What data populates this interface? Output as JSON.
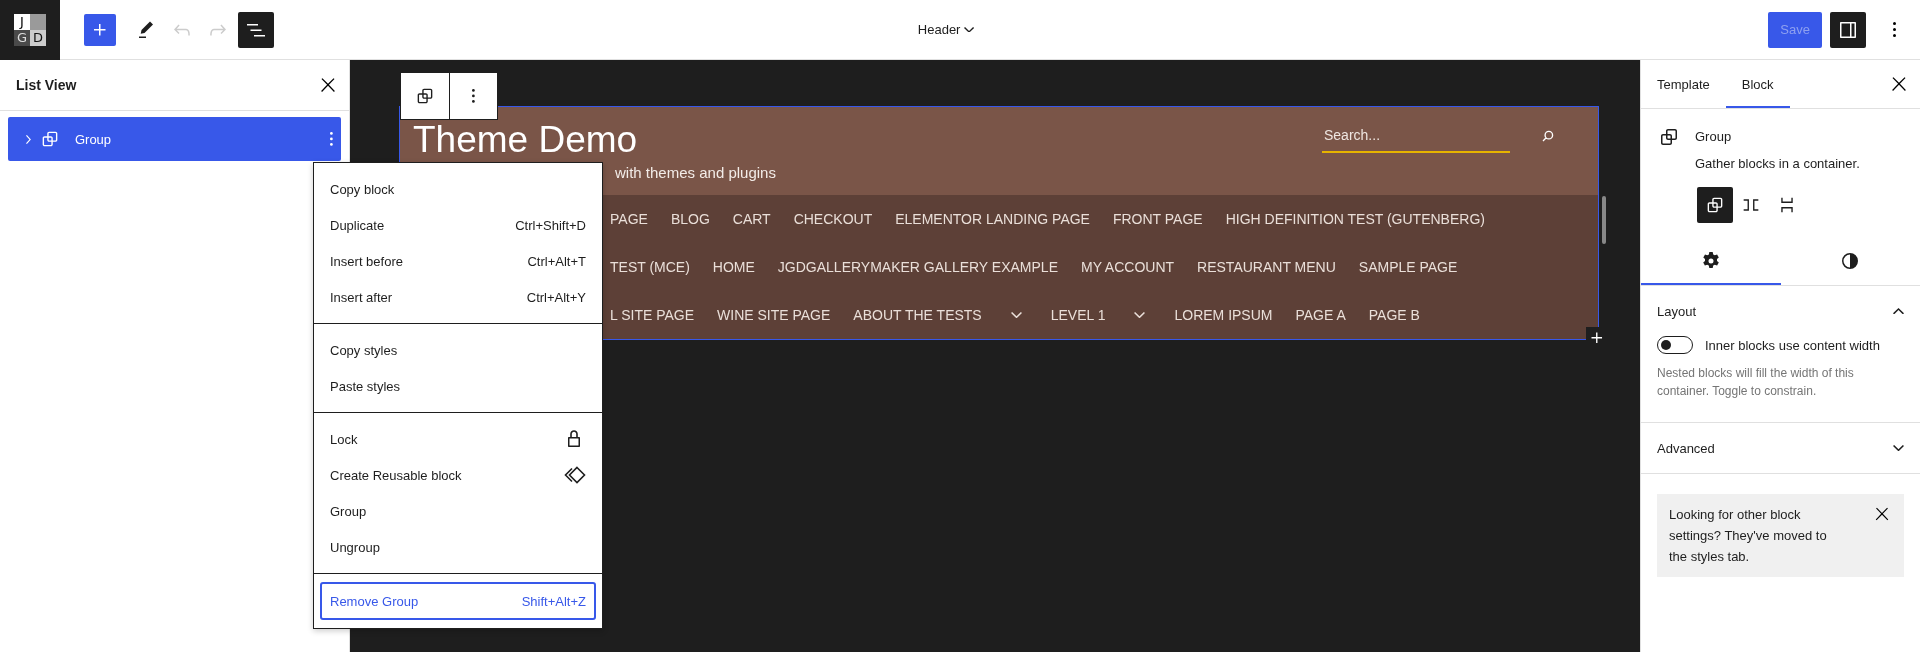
{
  "top_bar": {
    "logo": {
      "letters": [
        "J",
        "G",
        "D"
      ]
    },
    "tools": [
      {
        "kind": "add",
        "pressed": false,
        "disabled": false
      },
      {
        "kind": "edit",
        "pressed": false,
        "disabled": false
      },
      {
        "kind": "undo",
        "pressed": false,
        "disabled": true
      },
      {
        "kind": "redo",
        "pressed": false,
        "disabled": true
      },
      {
        "kind": "list-view",
        "pressed": true,
        "disabled": false
      }
    ],
    "document_title": "Header",
    "save": {
      "label": "Save",
      "disabled": true
    },
    "settings_toggle": {
      "pressed": true
    }
  },
  "list_view": {
    "title": "List View",
    "items": [
      {
        "label": "Group",
        "selected": true,
        "expanded": false
      }
    ]
  },
  "header_block": {
    "site_title": "Theme Demo",
    "tagline": "with themes and plugins",
    "search": {
      "placeholder": "Search..."
    },
    "nav_rows": [
      [
        {
          "kind": "link",
          "label": "PAGE"
        },
        {
          "kind": "link",
          "label": "BLOG"
        },
        {
          "kind": "link",
          "label": "CART"
        },
        {
          "kind": "link",
          "label": "CHECKOUT"
        },
        {
          "kind": "link",
          "label": "ELEMENTOR LANDING PAGE"
        },
        {
          "kind": "link",
          "label": "FRONT PAGE"
        },
        {
          "kind": "link",
          "label": "HIGH DEFINITION TEST (GUTENBERG)"
        }
      ],
      [
        {
          "kind": "link",
          "label": "TEST (MCE)"
        },
        {
          "kind": "link",
          "label": "HOME"
        },
        {
          "kind": "link",
          "label": "JGDGALLERYMAKER GALLERY EXAMPLE"
        },
        {
          "kind": "link",
          "label": "MY ACCOUNT"
        },
        {
          "kind": "link",
          "label": "RESTAURANT MENU"
        },
        {
          "kind": "link",
          "label": "SAMPLE PAGE"
        }
      ],
      [
        {
          "kind": "link",
          "label": "L SITE PAGE"
        },
        {
          "kind": "link",
          "label": "WINE SITE PAGE"
        },
        {
          "kind": "link",
          "label": "ABOUT THE TESTS"
        },
        {
          "kind": "submenu",
          "expanded": false
        },
        {
          "kind": "link",
          "label": "LEVEL 1"
        },
        {
          "kind": "submenu",
          "expanded": false
        },
        {
          "kind": "link",
          "label": "LOREM IPSUM"
        },
        {
          "kind": "link",
          "label": "PAGE A"
        },
        {
          "kind": "link",
          "label": "PAGE B"
        }
      ]
    ]
  },
  "context_menu": {
    "groups": [
      [
        {
          "kind": "plain",
          "label": "Copy block",
          "selected": false
        },
        {
          "kind": "plain",
          "label": "Duplicate",
          "shortcut": "Ctrl+Shift+D",
          "selected": false
        },
        {
          "kind": "plain",
          "label": "Insert before",
          "shortcut": "Ctrl+Alt+T",
          "selected": false
        },
        {
          "kind": "plain",
          "label": "Insert after",
          "shortcut": "Ctrl+Alt+Y",
          "selected": false
        }
      ],
      [
        {
          "kind": "plain",
          "label": "Copy styles",
          "selected": false
        },
        {
          "kind": "plain",
          "label": "Paste styles",
          "selected": false
        }
      ],
      [
        {
          "kind": "lock",
          "label": "Lock",
          "selected": false
        },
        {
          "kind": "reusable",
          "label": "Create Reusable block",
          "selected": false
        },
        {
          "kind": "plain",
          "label": "Group",
          "selected": false
        },
        {
          "kind": "plain",
          "label": "Ungroup",
          "selected": false
        }
      ],
      [
        {
          "kind": "plain",
          "label": "Remove Group",
          "shortcut": "Shift+Alt+Z",
          "selected": true
        }
      ]
    ]
  },
  "sidebar": {
    "tabs": [
      {
        "label": "Template",
        "selected": false
      },
      {
        "label": "Block",
        "selected": true
      }
    ],
    "block": {
      "name": "Group",
      "description": "Gather blocks in a container."
    },
    "variations": [
      {
        "kind": "group",
        "selected": true
      },
      {
        "kind": "row",
        "selected": false
      },
      {
        "kind": "stack",
        "selected": false
      }
    ],
    "inspector_tabs": [
      {
        "kind": "settings",
        "selected": true
      },
      {
        "kind": "styles",
        "selected": false
      }
    ],
    "panels": [
      {
        "title": "Layout",
        "expanded": true,
        "toggle": {
          "label": "Inner blocks use content width",
          "on": false
        },
        "help": "Nested blocks will fill the width of this container. Toggle to constrain."
      },
      {
        "title": "Advanced",
        "expanded": false
      }
    ],
    "notice": {
      "text": "Looking for other block settings? They've moved to the styles tab."
    }
  }
}
